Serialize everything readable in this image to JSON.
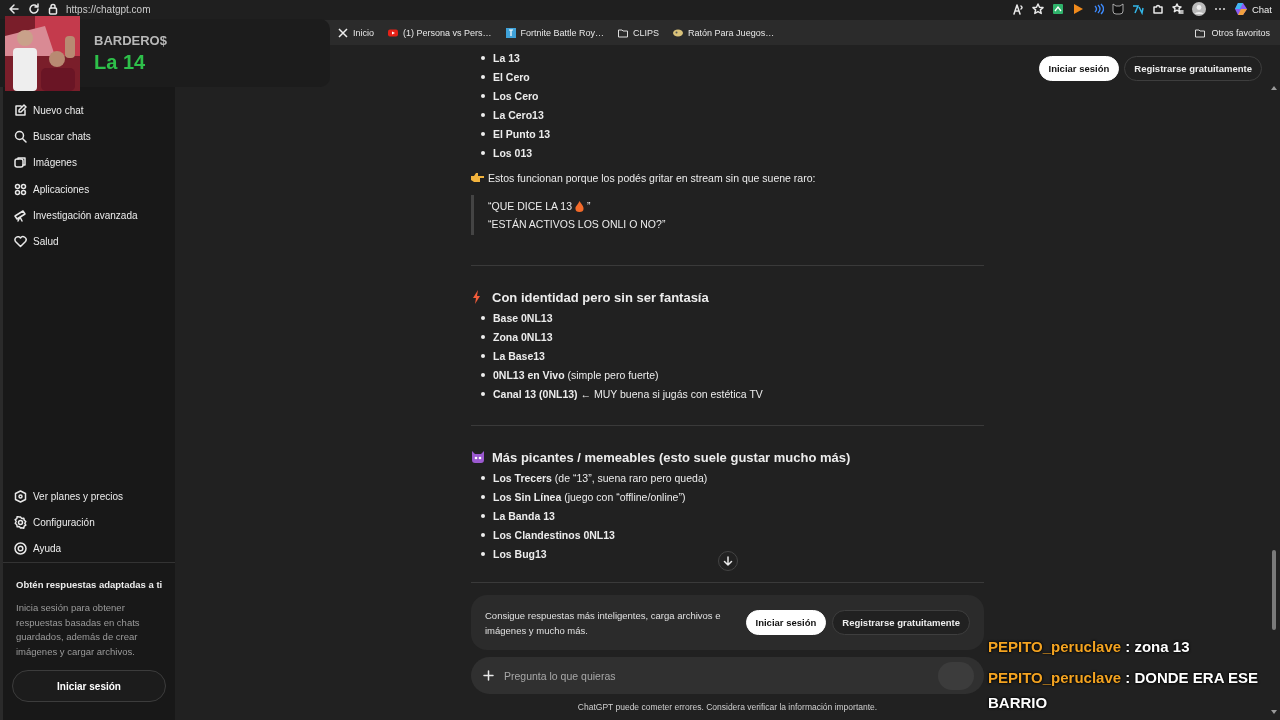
{
  "browser": {
    "url": "https://chatgpt.com",
    "bookmarks": [
      {
        "label": "Inicio"
      },
      {
        "label": "(1) Persona vs Pers…"
      },
      {
        "label": "Fortnite Battle Roy…"
      },
      {
        "label": "CLIPS"
      },
      {
        "label": "Ratón Para Juegos…"
      }
    ],
    "other_bookmarks": "Otros favoritos",
    "copilot_label": "Chat"
  },
  "stream_overlay": {
    "kind": "picture",
    "channel": "BARDERO$",
    "title": "La 14"
  },
  "sidebar": {
    "items": [
      {
        "label": "Nuevo chat"
      },
      {
        "label": "Buscar chats"
      },
      {
        "label": "Imágenes"
      },
      {
        "label": "Aplicaciones"
      },
      {
        "label": "Investigación avanzada"
      },
      {
        "label": "Salud"
      }
    ],
    "bottom_items": [
      {
        "label": "Ver planes y precios"
      },
      {
        "label": "Configuración"
      },
      {
        "label": "Ayuda"
      }
    ],
    "promo": {
      "title": "Obtén respuestas adaptadas a ti",
      "text": "Inicia sesión para obtener respuestas basadas en chats guardados, además de crear imágenes y cargar archivos.",
      "button": "Iniciar sesión"
    }
  },
  "header_buttons": [
    {
      "label": "Iniciar sesión",
      "kind": "primary"
    },
    {
      "label": "Registrarse gratuitamente",
      "kind": "secondary"
    }
  ],
  "message": [
    {
      "kind": "list",
      "items": [
        {
          "text": "**La 13**"
        },
        {
          "text": "**El Cero**"
        },
        {
          "text": "**Los Cero**"
        },
        {
          "text": "**La Cero13**"
        },
        {
          "text": "**El Punto 13**"
        },
        {
          "text": "**Los 013**"
        }
      ]
    },
    {
      "kind": "paragraph",
      "text": "Estos funcionan porque los podés gritar en stream sin que suene raro:"
    },
    {
      "kind": "quote",
      "lines": [
        {
          "text": "“QUE DICE LA 13",
          "suffix": "”"
        },
        {
          "text": "“ESTÁN ACTIVOS LOS ONLI O NO?”"
        }
      ]
    },
    {
      "kind": "rule"
    },
    {
      "kind": "heading",
      "text": "Con identidad pero sin ser fantasía"
    },
    {
      "kind": "list",
      "items": [
        {
          "text": "**Base 0NL13**"
        },
        {
          "text": "**Zona 0NL13**"
        },
        {
          "text": "**La Base13**"
        },
        {
          "text": "**0NL13 en Vivo** (simple pero fuerte)"
        },
        {
          "text": "**Canal 13 (0NL13)** ← MUY buena si jugás con estética TV"
        }
      ]
    },
    {
      "kind": "rule"
    },
    {
      "kind": "heading",
      "text": "Más picantes / memeables (esto suele gustar mucho más)"
    },
    {
      "kind": "list",
      "items": [
        {
          "text": "**Los Trecers** (de “13”, suena raro pero queda)"
        },
        {
          "text": "**Los Sin Línea** (juego con “offline/online”)"
        },
        {
          "text": "**La Banda 13**"
        },
        {
          "text": "**Los Clandestinos 0NL13**"
        },
        {
          "text": "**Los Bug13**"
        }
      ]
    }
  ],
  "composer": {
    "banner_text": "Consigue respuestas más inteligentes, carga archivos e imágenes y mucho más.",
    "buttons": [
      {
        "label": "Iniciar sesión",
        "kind": "primary"
      },
      {
        "label": "Registrarse gratuitamente",
        "kind": "secondary"
      }
    ],
    "placeholder": "Pregunta lo que quieras",
    "disclaimer": "ChatGPT puede cometer errores. Considera verificar la información importante."
  },
  "chat_overlay": {
    "messages": [
      {
        "user": "PEPITO_peruclave",
        "text": ": zona 13"
      },
      {
        "user": "PEPITO_peruclave",
        "text": ": DONDE ERA ESE BARRIO"
      }
    ]
  }
}
